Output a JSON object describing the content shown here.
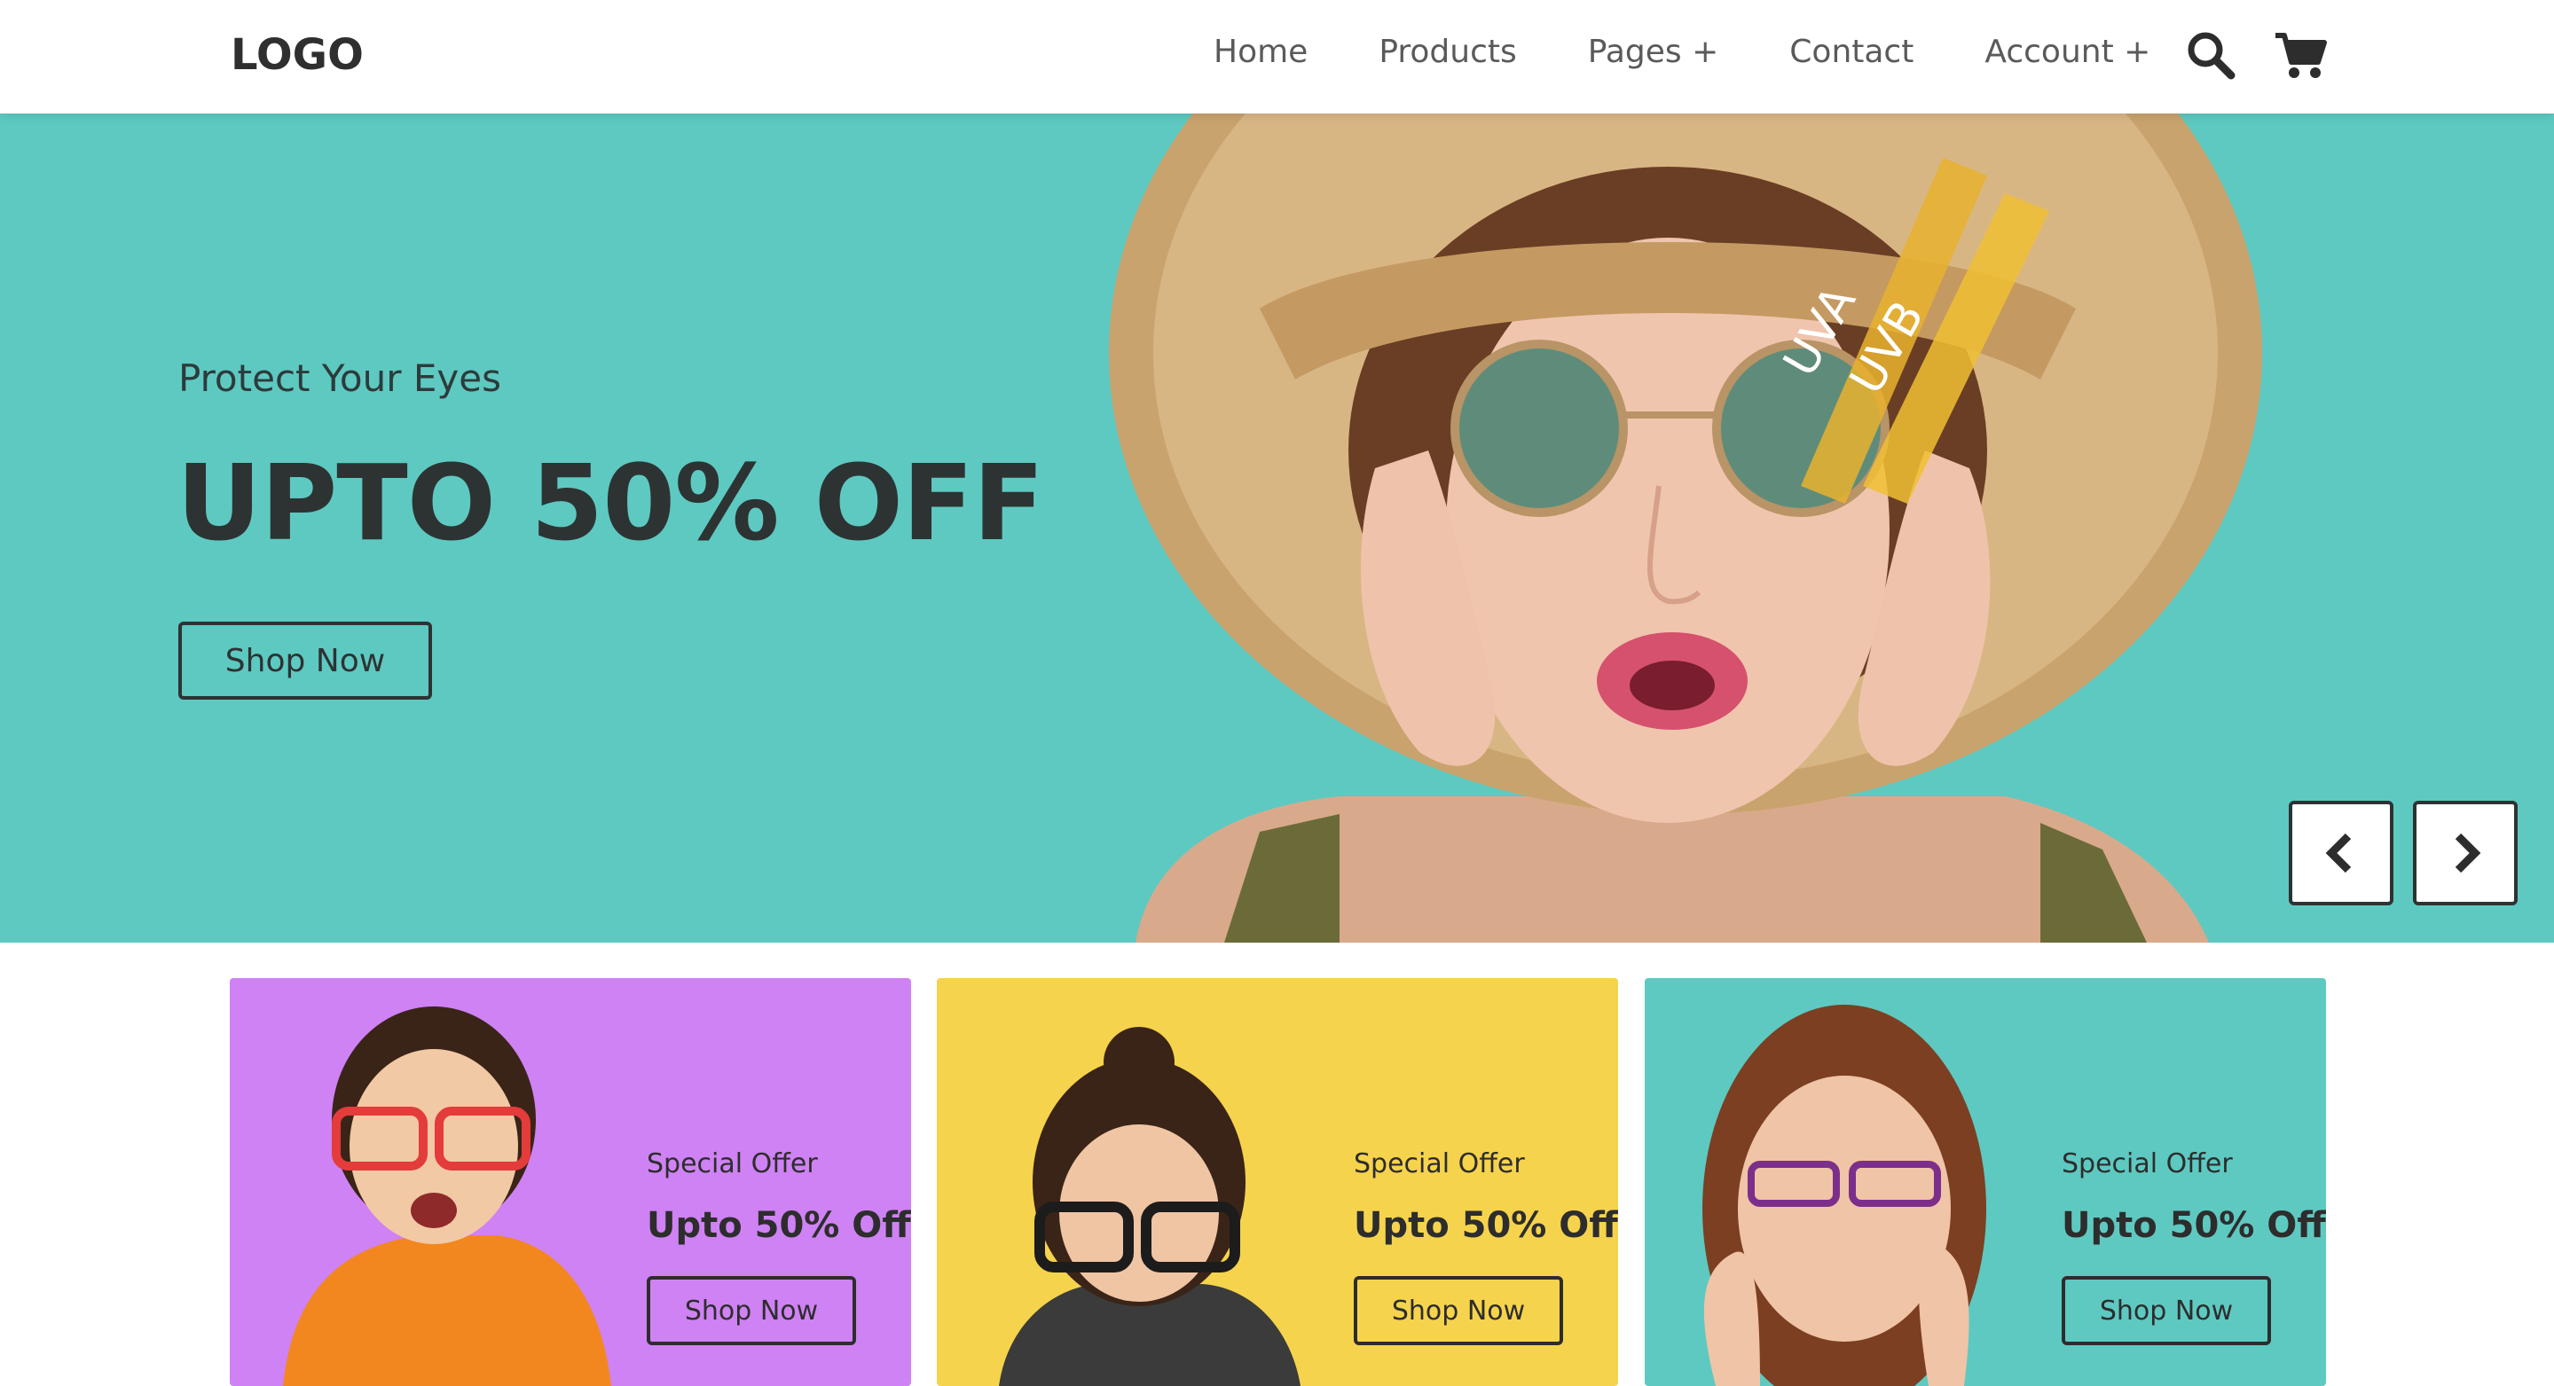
{
  "navbar": {
    "logo": "LOGO",
    "links": [
      "Home",
      "Products",
      "Pages +",
      "Contact",
      "Account +"
    ],
    "icons": [
      "search-icon",
      "cart-icon"
    ]
  },
  "hero": {
    "subtitle": "Protect Your Eyes",
    "title": "UPTO 50% OFF",
    "button": "Shop Now",
    "image_text": [
      "UVA",
      "UVB"
    ],
    "background": "#5ec9c1",
    "prev_icon": "chevron-left-icon",
    "next_icon": "chevron-right-icon"
  },
  "offers": [
    {
      "label": "Special Offer",
      "title": "Upto 50% Off",
      "button": "Shop Now",
      "color": "#cf82f3"
    },
    {
      "label": "Special Offer",
      "title": "Upto 50% Off",
      "button": "Shop Now",
      "color": "#f6d34c"
    },
    {
      "label": "Special Offer",
      "title": "Upto 50% Off",
      "button": "Shop Now",
      "color": "#5ec9c1"
    }
  ]
}
